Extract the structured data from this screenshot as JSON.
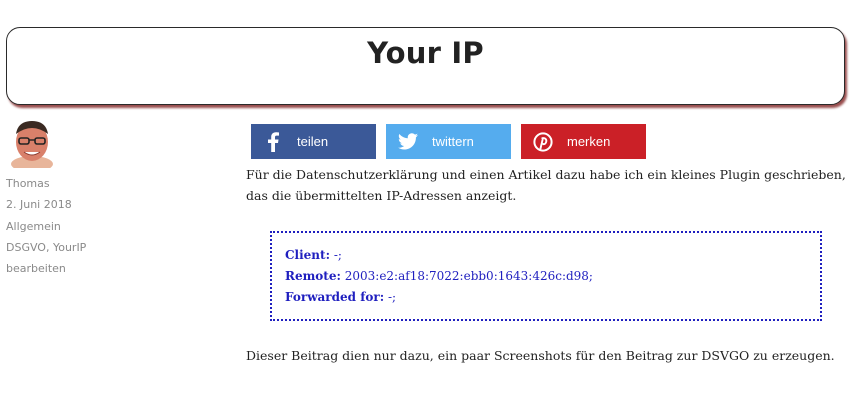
{
  "header": {
    "title": "Your IP"
  },
  "meta": {
    "author": "Thomas",
    "date": "2. Juni 2018",
    "category": "Allgemein",
    "tags": "DSGVO, YourIP",
    "edit": "bearbeiten"
  },
  "share": {
    "facebook_label": "teilen",
    "twitter_label": "twittern",
    "pinterest_label": "merken",
    "facebook_color": "#3b5998",
    "twitter_color": "#55acee",
    "pinterest_color": "#cb2027"
  },
  "content": {
    "intro": "Für die Datenschutzerklärung und einen Artikel dazu habe ich ein kleines Plugin geschrieben, das die übermittelten IP-Adressen anzeigt.",
    "ip": {
      "client_label": "Client:",
      "client_value": " -;",
      "remote_label": "Remote:",
      "remote_value": " 2003:e2:af18:7022:ebb0:1643:426c:d98;",
      "forwarded_label": "Forwarded for:",
      "forwarded_value": " -;"
    },
    "outro": "Dieser Beitrag dien nur dazu, ein paar Screenshots für den Beitrag zur DSVGO zu erzeugen."
  }
}
